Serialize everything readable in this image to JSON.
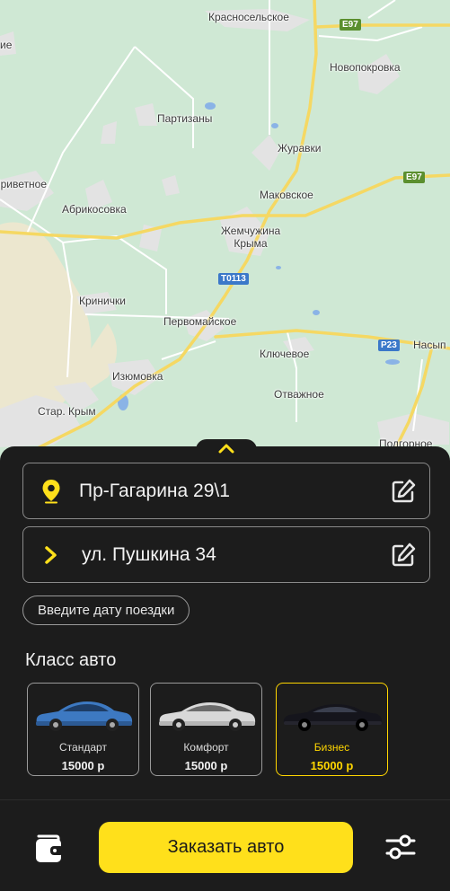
{
  "map": {
    "places": [
      {
        "id": "krasnoselskoe",
        "label": "Красносельское"
      },
      {
        "id": "novopokrovka",
        "label": "Новопокровка"
      },
      {
        "id": "partizany",
        "label": "Партизаны"
      },
      {
        "id": "zhuravki",
        "label": "Журавки"
      },
      {
        "id": "privetnoe",
        "label": "Приветное"
      },
      {
        "id": "abrikosovka",
        "label": "Абрикосовка"
      },
      {
        "id": "makovskoe",
        "label": "Маковское"
      },
      {
        "id": "zhemchuzhina",
        "label": "Жемчужина Крыма"
      },
      {
        "id": "krinichki",
        "label": "Кринички"
      },
      {
        "id": "pervomayskoe",
        "label": "Первомайское"
      },
      {
        "id": "klyuchevoe",
        "label": "Ключевое"
      },
      {
        "id": "nasyp",
        "label": "Насып"
      },
      {
        "id": "izyumovka",
        "label": "Изюмовка"
      },
      {
        "id": "otvazhnoe",
        "label": "Отважное"
      },
      {
        "id": "star_krym",
        "label": "Стар. Крым"
      },
      {
        "id": "podgornoe",
        "label": "Подгорное"
      },
      {
        "id": "edge_left",
        "label": "ие"
      }
    ],
    "road_shields": {
      "e97_top": "E97",
      "e97_mid": "E97",
      "t0113": "Т0113",
      "p23": "P23"
    }
  },
  "route": {
    "from": "Пр-Гагарина 29\\1",
    "to": "ул. Пушкина 34"
  },
  "date_button": "Введите дату поездки",
  "car_class": {
    "title": "Класс авто",
    "options": [
      {
        "name": "Стандарт",
        "price": "15000 р",
        "color": "#3d79c2"
      },
      {
        "name": "Комфорт",
        "price": "15000 р",
        "color": "#d8d8d8"
      },
      {
        "name": "Бизнес",
        "price": "15000 р",
        "color": "#15151c"
      }
    ]
  },
  "order_button": "Заказать авто",
  "colors": {
    "accent": "#ffe01b",
    "background": "#1c1c1c",
    "map_land": "#cfe8d4"
  },
  "icons": {
    "from": "location-pin-icon",
    "to": "chevron-right-icon",
    "edit": "edit-icon",
    "wallet": "wallet-icon",
    "filters": "filters-icon",
    "handle": "chevron-up-icon"
  }
}
